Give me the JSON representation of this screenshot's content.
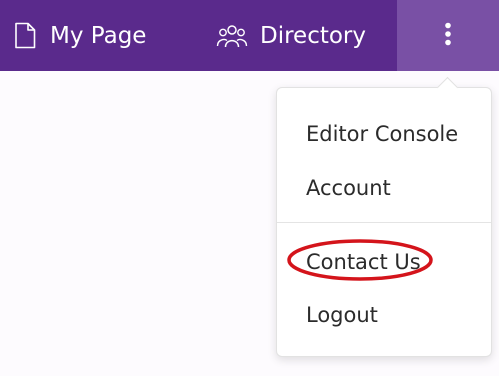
{
  "nav": {
    "my_page": {
      "label": "My Page",
      "icon": "document-icon"
    },
    "directory": {
      "label": "Directory",
      "icon": "people-icon"
    },
    "more": {
      "icon": "more-vertical-icon"
    }
  },
  "dropdown": {
    "items": [
      {
        "label": "Editor Console"
      },
      {
        "label": "Account"
      },
      {
        "label": "Contact Us",
        "highlighted": true
      },
      {
        "label": "Logout"
      }
    ]
  },
  "colors": {
    "topbar": "#5a2a8c",
    "more_button": "#7950a5",
    "highlight_ring": "#d4141b"
  }
}
